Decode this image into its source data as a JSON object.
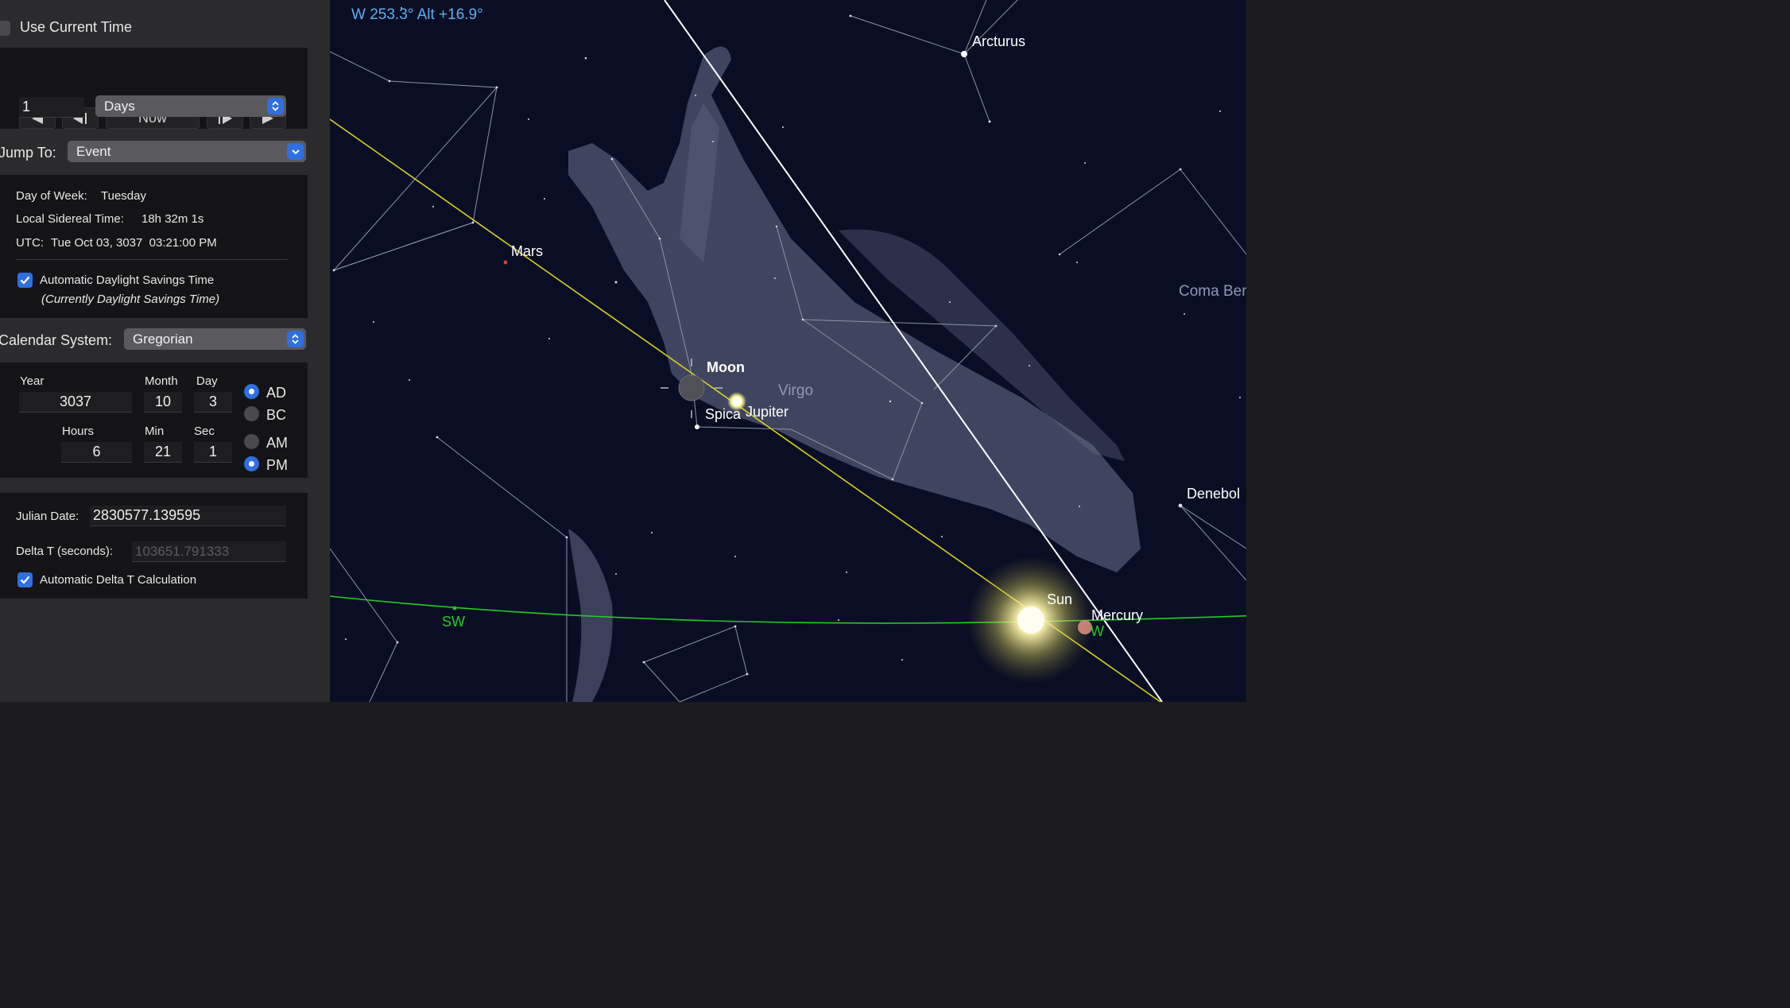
{
  "panel": {
    "use_current_time": {
      "label": "Use Current Time",
      "checked": false
    },
    "transport": {
      "now_label": "Now"
    },
    "step": {
      "amount": "1",
      "unit": "Days"
    },
    "jump_to": {
      "label": "Jump To:",
      "value": "Event"
    },
    "info": {
      "day_of_week_label": "Day of Week:",
      "day_of_week": "Tuesday",
      "lst_label": "Local Sidereal Time:",
      "lst": "18h 32m 1s",
      "utc_label": "UTC:",
      "utc": "Tue Oct 03, 3037  03:21:00 PM",
      "auto_dst_label": "Automatic Daylight Savings Time",
      "auto_dst_checked": true,
      "dst_note": "(Currently Daylight Savings Time)"
    },
    "calendar": {
      "label": "Calendar System:",
      "value": "Gregorian"
    },
    "date": {
      "year_label": "Year",
      "year": "3037",
      "month_label": "Month",
      "month": "10",
      "day_label": "Day",
      "day": "3",
      "era_ad": "AD",
      "era_bc": "BC",
      "era_selected": "AD"
    },
    "time": {
      "hours_label": "Hours",
      "hours": "6",
      "min_label": "Min",
      "min": "21",
      "sec_label": "Sec",
      "sec": "1",
      "am": "AM",
      "pm": "PM",
      "meridiem_selected": "PM"
    },
    "julian": {
      "label": "Julian Date:",
      "value": "2830577.139595"
    },
    "delta_t": {
      "label": "Delta T (seconds):",
      "value": "103651.791333"
    },
    "auto_delta_t": {
      "label": "Automatic Delta T Calculation",
      "checked": true
    }
  },
  "sky": {
    "coordinates": "W 253.3° Alt +16.9°",
    "objects": {
      "arcturus": "Arcturus",
      "mars": "Mars",
      "moon": "Moon",
      "virgo": "Virgo",
      "spica": "Spica",
      "jupiter": "Jupiter",
      "coma": "Coma Ber",
      "denebola": "Denebol",
      "sun": "Sun",
      "mercury": "Mercury"
    },
    "compass": {
      "sw": "SW",
      "w": "W"
    },
    "colors": {
      "background": "#0a0e24",
      "coordinates": "#5ab0f0",
      "ecliptic": "#d8d020",
      "horizon": "#22cc22",
      "meridian": "#ffffff",
      "constellation_lines": "#8c93a6",
      "constellation_art": "#6e7290"
    }
  }
}
